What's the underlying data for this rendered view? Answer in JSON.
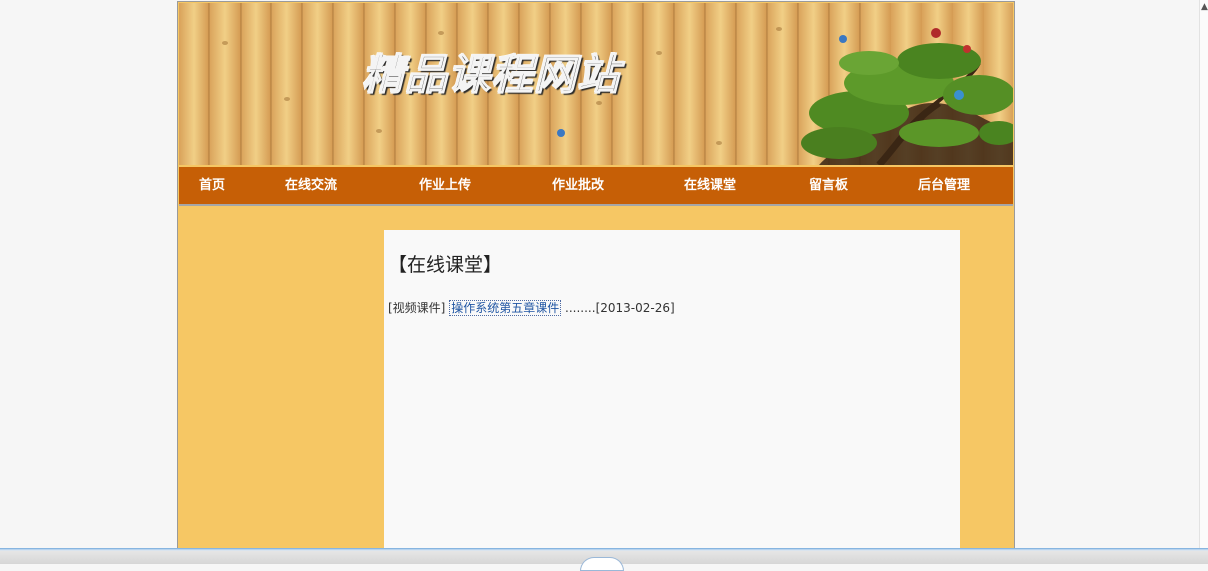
{
  "banner": {
    "site_title": "精品课程网站",
    "colors": {
      "wood": "#e2b368",
      "tree": "#4f8a22",
      "bark": "#3a2614"
    }
  },
  "nav": {
    "items": [
      {
        "label": "首页"
      },
      {
        "label": "在线交流"
      },
      {
        "label": "作业上传"
      },
      {
        "label": "作业批改"
      },
      {
        "label": "在线课堂"
      },
      {
        "label": "留言板"
      },
      {
        "label": "后台管理"
      }
    ],
    "color": "#c65f06"
  },
  "main": {
    "section_title": "【在线课堂】",
    "entries": [
      {
        "category": "[视频课件]",
        "title": "操作系统第五章课件",
        "dots": "........",
        "date": "[2013-02-26]"
      }
    ]
  },
  "theme": {
    "page_background": "#f6c764",
    "content_background": "#f9f9f9",
    "link_color": "#1f55a3"
  }
}
